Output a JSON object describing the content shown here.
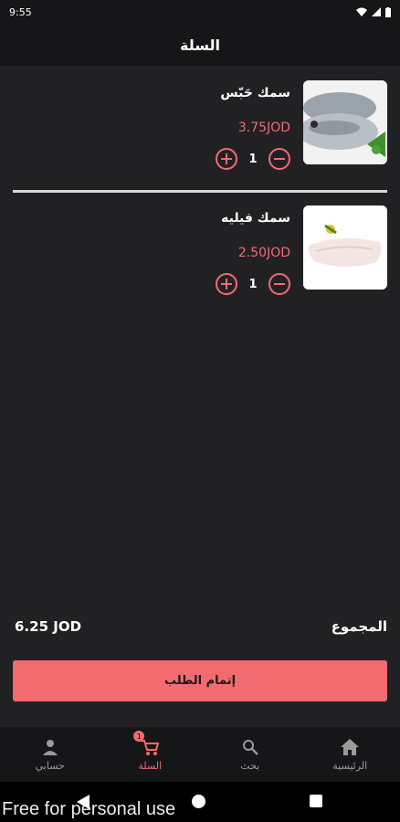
{
  "status_bar": {
    "time": "9:55"
  },
  "app_bar": {
    "title": "السلة"
  },
  "cart": {
    "items": [
      {
        "name": "سمك حَبّس",
        "price": "3.75JOD",
        "quantity": "1",
        "image_icon": "fish-whole-photo"
      },
      {
        "name": "سمك فيليه",
        "price": "2.50JOD",
        "quantity": "1",
        "image_icon": "fish-fillet-photo"
      }
    ]
  },
  "summary": {
    "total_label": "المجموع",
    "total_value": "6.25 JOD"
  },
  "checkout": {
    "label": "إتمام الطلب"
  },
  "nav": {
    "items": [
      {
        "label": "حسابي",
        "icon": "person-icon"
      },
      {
        "label": "السلة",
        "icon": "cart-icon",
        "badge": "1"
      },
      {
        "label": "بحث",
        "icon": "search-icon"
      },
      {
        "label": "الرئيسية",
        "icon": "home-icon"
      }
    ]
  },
  "colors": {
    "accent": "#f26b6f",
    "background": "#212124",
    "bar": "#161618"
  },
  "watermark": "Free for personal use"
}
